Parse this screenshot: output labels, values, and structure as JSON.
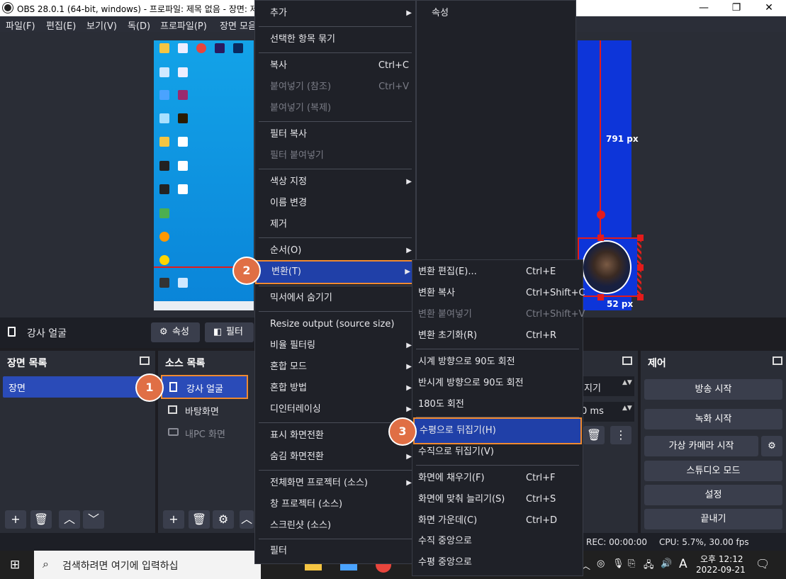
{
  "window": {
    "title": "OBS 28.0.1 (64-bit, windows) - 프로파일: 제목 없음 - 장면: 제"
  },
  "menubar": [
    "파일(F)",
    "편집(E)",
    "보기(V)",
    "독(D)",
    "프로파일(P)",
    "장면 모음"
  ],
  "preview": {
    "measure_v": "791 px",
    "measure_h": "52 px"
  },
  "source_bar": {
    "source_name": "강사 얼굴",
    "properties": "속성",
    "filters": "필터"
  },
  "scenes": {
    "title": "장면 목록",
    "items": [
      "장면"
    ]
  },
  "sources": {
    "title": "소스 목록",
    "items": [
      "강사 얼굴",
      "바탕화면",
      "내PC 화면"
    ]
  },
  "transitions": {
    "value1": "지기",
    "value2": "0 ms"
  },
  "controls": {
    "title": "제어",
    "buttons": [
      "방송 시작",
      "녹화 시작",
      "가상 카메라 시작",
      "스튜디오 모드",
      "설정",
      "끝내기"
    ]
  },
  "status": {
    "rec": "REC: 00:00:00",
    "cpu": "CPU: 5.7%, 30.00 fps"
  },
  "taskbar": {
    "search_placeholder": "검색하려면 여기에 입력하십",
    "time": "오후 12:12",
    "date": "2022-09-21",
    "ime": "A"
  },
  "context_menu": {
    "items": [
      {
        "label": "추가",
        "submenu": true
      },
      {
        "label": "선택한 항목 묶기"
      },
      {
        "label": "복사",
        "shortcut": "Ctrl+C"
      },
      {
        "label": "붙여넣기 (참조)",
        "shortcut": "Ctrl+V",
        "disabled": true
      },
      {
        "label": "붙여넣기 (복제)",
        "disabled": true
      },
      {
        "label": "필터 복사"
      },
      {
        "label": "필터 붙여넣기",
        "disabled": true
      },
      {
        "label": "색상 지정",
        "submenu": true
      },
      {
        "label": "이름 변경"
      },
      {
        "label": "제거"
      },
      {
        "label": "순서(O)",
        "submenu": true
      },
      {
        "label": "변환(T)",
        "submenu": true,
        "highlighted": true
      },
      {
        "label": "믹서에서 숨기기"
      },
      {
        "label": "Resize output (source size)"
      },
      {
        "label": "비율 필터링",
        "submenu": true
      },
      {
        "label": "혼합 모드",
        "submenu": true
      },
      {
        "label": "혼합 방법",
        "submenu": true
      },
      {
        "label": "디인터레이싱",
        "submenu": true
      },
      {
        "label": "표시 화면전환",
        "submenu": true
      },
      {
        "label": "숨김 화면전환",
        "submenu": true
      },
      {
        "label": "전체화면 프로젝터 (소스)",
        "submenu": true
      },
      {
        "label": "창 프로젝터 (소스)"
      },
      {
        "label": "스크린샷 (소스)"
      },
      {
        "label": "필터"
      }
    ]
  },
  "add_submenu": {
    "items": [
      "속성"
    ]
  },
  "transform_submenu": {
    "items": [
      {
        "label": "변환 편집(E)...",
        "shortcut": "Ctrl+E"
      },
      {
        "label": "변환 복사",
        "shortcut": "Ctrl+Shift+C"
      },
      {
        "label": "변환 붙여넣기",
        "shortcut": "Ctrl+Shift+V",
        "disabled": true
      },
      {
        "label": "변환 초기화(R)",
        "shortcut": "Ctrl+R"
      },
      {
        "label": "시계 방향으로 90도 회전"
      },
      {
        "label": "반시계 방향으로 90도 회전"
      },
      {
        "label": "180도 회전"
      },
      {
        "label": "수평으로 뒤집기(H)",
        "highlighted": true
      },
      {
        "label": "수직으로 뒤집기(V)"
      },
      {
        "label": "화면에 채우기(F)",
        "shortcut": "Ctrl+F"
      },
      {
        "label": "화면에 맞춰 늘리기(S)",
        "shortcut": "Ctrl+S"
      },
      {
        "label": "화면 가운데(C)",
        "shortcut": "Ctrl+D"
      },
      {
        "label": "수직 중앙으로"
      },
      {
        "label": "수평 중앙으로"
      }
    ]
  },
  "badges": [
    "1",
    "2",
    "3"
  ]
}
